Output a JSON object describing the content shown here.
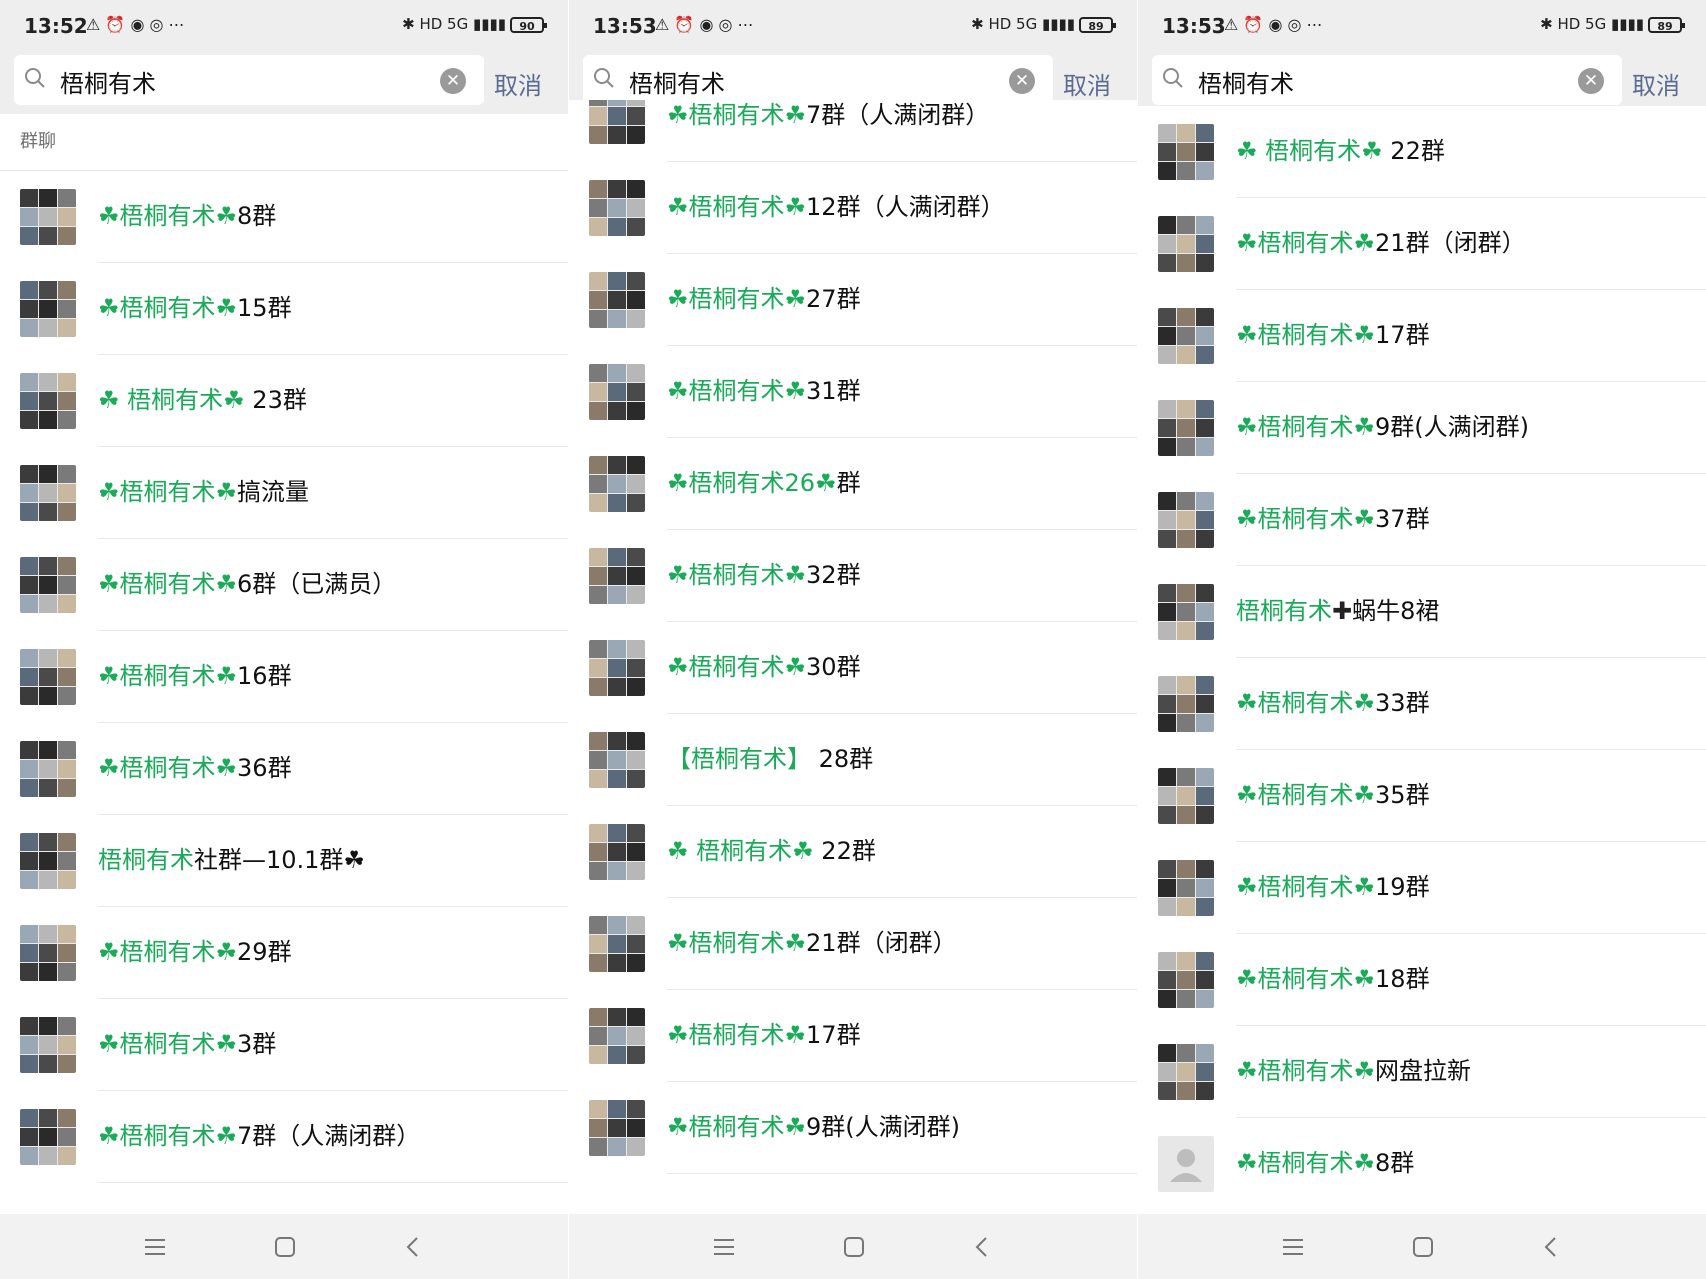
{
  "colors": {
    "keyword_green": "#1aab59",
    "cancel_blue": "#5b6b92"
  },
  "panels": [
    {
      "status": {
        "time": "13:52",
        "battery": "90"
      },
      "search": {
        "value": "梧桐有术",
        "cancel": "取消"
      },
      "section_label": "群聊",
      "items": [
        {
          "pre": "☘",
          "kw": "梧桐有术",
          "mid": "☘",
          "post": "8群"
        },
        {
          "pre": "☘",
          "kw": "梧桐有术",
          "mid": "☘",
          "post": "15群"
        },
        {
          "pre": "☘ ",
          "kw": " 梧桐有术",
          "mid": "☘",
          "post": " 23群"
        },
        {
          "pre": "☘",
          "kw": "梧桐有术",
          "mid": "☘",
          "post": "搞流量"
        },
        {
          "pre": "☘",
          "kw": "梧桐有术",
          "mid": "☘",
          "post": "6群（已满员）"
        },
        {
          "pre": "☘",
          "kw": "梧桐有术",
          "mid": "☘",
          "post": "16群"
        },
        {
          "pre": "☘",
          "kw": "梧桐有术",
          "mid": "☘",
          "post": "36群"
        },
        {
          "pre": "",
          "kw": "梧桐有术",
          "mid": "",
          "post": "社群—10.1群☘"
        },
        {
          "pre": "☘",
          "kw": "梧桐有术",
          "mid": "☘",
          "post": "29群"
        },
        {
          "pre": "☘",
          "kw": "梧桐有术",
          "mid": "☘",
          "post": "3群"
        },
        {
          "pre": "☘",
          "kw": "梧桐有术",
          "mid": "☘",
          "post": "7群（人满闭群）"
        }
      ]
    },
    {
      "status": {
        "time": "13:53",
        "battery": "89"
      },
      "search": {
        "value": "梧桐有术",
        "cancel": "取消"
      },
      "items": [
        {
          "pre": "☘",
          "kw": "梧桐有术",
          "mid": "☘",
          "post": "7群（人满闭群）"
        },
        {
          "pre": "☘",
          "kw": "梧桐有术",
          "mid": "☘",
          "post": "12群（人满闭群）"
        },
        {
          "pre": "☘",
          "kw": "梧桐有术",
          "mid": "☘",
          "post": "27群"
        },
        {
          "pre": "☘",
          "kw": "梧桐有术",
          "mid": "☘",
          "post": "31群"
        },
        {
          "pre": "☘",
          "kw": "梧桐有术",
          "mid": "26☘",
          "post": "群"
        },
        {
          "pre": "☘",
          "kw": "梧桐有术",
          "mid": "☘",
          "post": "32群"
        },
        {
          "pre": "☘",
          "kw": "梧桐有术",
          "mid": "☘",
          "post": "30群"
        },
        {
          "pre": "【",
          "kw": "梧桐有术",
          "mid": "】",
          "post": " 28群"
        },
        {
          "pre": "☘ ",
          "kw": " 梧桐有术",
          "mid": "☘",
          "post": " 22群"
        },
        {
          "pre": "☘",
          "kw": "梧桐有术",
          "mid": "☘",
          "post": "21群（闭群）"
        },
        {
          "pre": "☘",
          "kw": "梧桐有术",
          "mid": "☘",
          "post": "17群"
        },
        {
          "pre": "☘",
          "kw": "梧桐有术",
          "mid": "☘",
          "post": "9群(人满闭群)"
        }
      ]
    },
    {
      "status": {
        "time": "13:53",
        "battery": "89"
      },
      "search": {
        "value": "梧桐有术",
        "cancel": "取消"
      },
      "items": [
        {
          "pre": "☘ ",
          "kw": " 梧桐有术",
          "mid": "☘",
          "post": " 22群"
        },
        {
          "pre": "☘",
          "kw": "梧桐有术",
          "mid": "☘",
          "post": "21群（闭群）"
        },
        {
          "pre": "☘",
          "kw": "梧桐有术",
          "mid": "☘",
          "post": "17群"
        },
        {
          "pre": "☘",
          "kw": "梧桐有术",
          "mid": "☘",
          "post": "9群(人满闭群)"
        },
        {
          "pre": "☘",
          "kw": "梧桐有术",
          "mid": "☘",
          "post": "37群"
        },
        {
          "pre": "",
          "kw": "梧桐有术",
          "mid": "✚",
          "post": "蜗牛8裙"
        },
        {
          "pre": "☘",
          "kw": "梧桐有术",
          "mid": "☘",
          "post": "33群"
        },
        {
          "pre": "☘",
          "kw": "梧桐有术",
          "mid": "☘",
          "post": "35群"
        },
        {
          "pre": "☘",
          "kw": "梧桐有术",
          "mid": "☘",
          "post": "19群"
        },
        {
          "pre": "☘",
          "kw": "梧桐有术",
          "mid": "☘",
          "post": "18群"
        },
        {
          "pre": "☘",
          "kw": "梧桐有术",
          "mid": "☘",
          "post": "网盘拉新"
        },
        {
          "pre": "☘",
          "kw": "梧桐有术",
          "mid": "☘",
          "post": "8群",
          "single_avatar": true
        }
      ]
    }
  ]
}
